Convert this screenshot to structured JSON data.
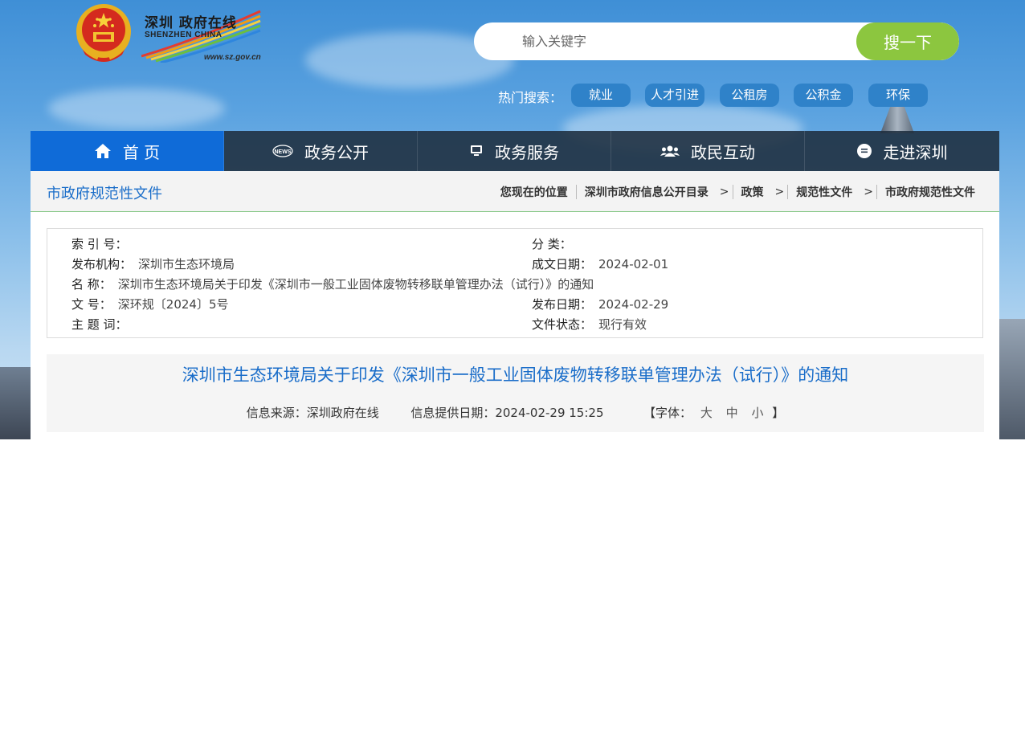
{
  "logo": {
    "chinese": "深圳 政府在线",
    "english": "SHENZHEN  CHINA",
    "url": "www.sz.gov.cn"
  },
  "search": {
    "placeholder": "输入关键字",
    "button_label": "搜一下"
  },
  "hot_search": {
    "label": "热门搜索：",
    "tags": [
      "就业",
      "人才引进",
      "公租房",
      "公积金",
      "环保"
    ]
  },
  "nav": {
    "items": [
      {
        "label": "首 页",
        "icon": "home-icon"
      },
      {
        "label": "政务公开",
        "icon": "news-icon"
      },
      {
        "label": "政务服务",
        "icon": "monitor-icon"
      },
      {
        "label": "政民互动",
        "icon": "people-icon"
      },
      {
        "label": "走进深圳",
        "icon": "chat-bubble-icon"
      }
    ]
  },
  "section": {
    "title": "市政府规范性文件"
  },
  "breadcrumb": {
    "prefix": "您现在的位置",
    "items": [
      "深圳市政府信息公开目录",
      "政策",
      "规范性文件",
      "市政府规范性文件"
    ],
    "separator": ">"
  },
  "meta": {
    "index_no_label": "索 引 号：",
    "index_no_value": "",
    "category_label": "分 类：",
    "category_value": "",
    "issuer_label": "发布机构：",
    "issuer_value": "深圳市生态环境局",
    "written_date_label": "成文日期：",
    "written_date_value": "2024-02-01",
    "name_label": "名 称：",
    "name_value": "深圳市生态环境局关于印发《深圳市一般工业固体废物转移联单管理办法（试行）》的通知",
    "doc_no_label": "文 号：",
    "doc_no_value": "深环规〔2024〕5号",
    "publish_date_label": "发布日期：",
    "publish_date_value": "2024-02-29",
    "keywords_label": "主 题 词：",
    "keywords_value": "",
    "status_label": "文件状态：",
    "status_value": "现行有效"
  },
  "document": {
    "title": "深圳市生态环境局关于印发《深圳市一般工业固体废物转移联单管理办法（试行）》的通知",
    "source": "信息来源：深圳政府在线",
    "provide_date": "信息提供日期：2024-02-29 15:25",
    "font_label_open": "【字体：",
    "font_large": "大",
    "font_medium": "中",
    "font_small": "小",
    "font_label_close": "】"
  },
  "colors": {
    "nav_active": "#0f6bd8",
    "search_button": "#8cc63f",
    "hot_tag": "#2f82c9",
    "link_blue": "#1a6dc9"
  }
}
